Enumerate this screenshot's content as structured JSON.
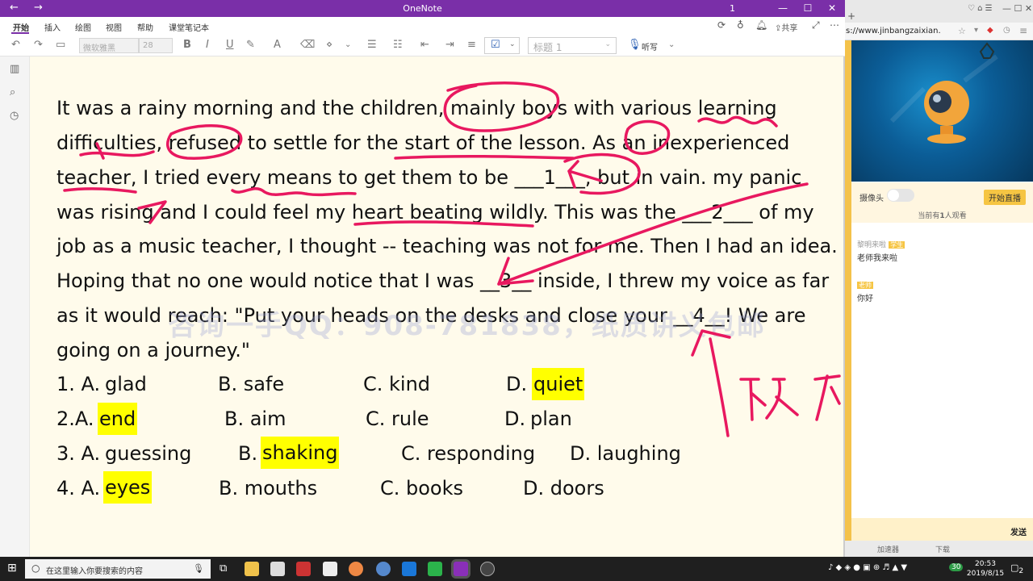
{
  "window": {
    "title": "OneNote",
    "page_indicator": "1",
    "share_label": "共享"
  },
  "menu": {
    "items": [
      "开始",
      "插入",
      "绘图",
      "视图",
      "帮助",
      "课堂笔记本"
    ]
  },
  "toolbar": {
    "font_name": "微软雅黑",
    "font_size": "28",
    "style": "标题 1",
    "dictate": "听写"
  },
  "content": {
    "paragraph": [
      "It was a rainy morning and the children, mainly boys with various learning",
      "difficulties, refused to settle for the start of the lesson. As an inexperienced",
      " teacher, I tried every means to get them to be ___1___, but in vain. my panic",
      " was rising and I could feel my heart beating wildly. This was the ___2___ of my",
      "job as a music teacher, I thought -- teaching was not for me. Then I had an idea.",
      "Hoping that no one would notice that I was __3__ inside, I threw my voice as far",
      " as it would reach: \"Put your heads on the desks and close your __4__! We are",
      "going on a journey.\""
    ],
    "options": [
      {
        "num": "1. A.",
        "a": "glad",
        "b": "B. safe",
        "c": "C. kind",
        "d_prefix": "D.",
        "d": "quiet"
      },
      {
        "num": "2.A.",
        "a": "end",
        "b": "B. aim",
        "c": "C. rule",
        "d_prefix": "D.",
        "d": "plan"
      },
      {
        "num": "3. A.",
        "a": "guessing",
        "b_prefix": "B.",
        "b": "shaking",
        "c": "C. responding",
        "d": "D. laughing"
      },
      {
        "num": "4. A.",
        "a": "eyes",
        "b": "B. mouths",
        "c": "C. books",
        "d": "D. doors"
      }
    ],
    "watermark": "咨询一手QQ：908-781838，纸质讲义包邮",
    "handwriting": "下文"
  },
  "browser": {
    "url": "s://www.jinbangzaixian.",
    "camera_label": "摄像头",
    "start_live": "开始直播",
    "viewers_prefix": "当前有",
    "viewers_count": "1",
    "viewers_suffix": "人观看",
    "chat": [
      {
        "user": "黎明来啦",
        "badge": "学生",
        "msg": "老师我来啦"
      },
      {
        "user": "",
        "badge": "老师",
        "msg": "你好"
      }
    ],
    "send": "发送",
    "status": [
      "加速器",
      "下载"
    ]
  },
  "taskbar": {
    "search_placeholder": "在这里输入你要搜索的内容",
    "time": "20:53",
    "date": "2019/8/15",
    "badge_count": "30",
    "notif": "2"
  },
  "colors": {
    "titlebar": "#7a2fa8",
    "ink": "#e8185f",
    "highlight": "#ffff00"
  }
}
